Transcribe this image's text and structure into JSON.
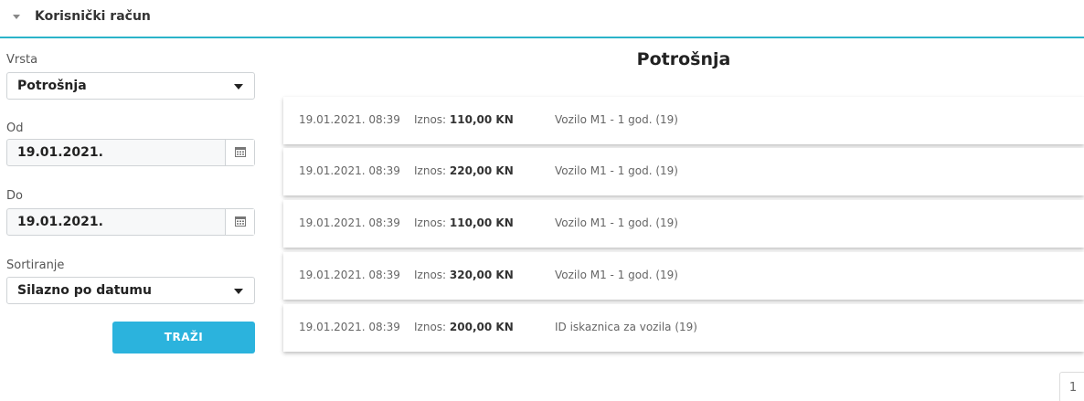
{
  "section": {
    "title": "Korisnički račun"
  },
  "filters": {
    "type": {
      "label": "Vrsta",
      "value": "Potrošnja"
    },
    "from": {
      "label": "Od",
      "value": "19.01.2021."
    },
    "to": {
      "label": "Do",
      "value": "19.01.2021."
    },
    "sort": {
      "label": "Sortiranje",
      "value": "Silazno po datumu"
    },
    "search_button": "TRAŽI"
  },
  "main": {
    "title": "Potrošnja",
    "amount_label": "Iznos:",
    "items": [
      {
        "date": "19.01.2021. 08:39",
        "amount": "110,00 KN",
        "description": "Vozilo M1 - 1 god. (19)"
      },
      {
        "date": "19.01.2021. 08:39",
        "amount": "220,00 KN",
        "description": "Vozilo M1 - 1 god. (19)"
      },
      {
        "date": "19.01.2021. 08:39",
        "amount": "110,00 KN",
        "description": "Vozilo M1 - 1 god. (19)"
      },
      {
        "date": "19.01.2021. 08:39",
        "amount": "320,00 KN",
        "description": "Vozilo M1 - 1 god. (19)"
      },
      {
        "date": "19.01.2021. 08:39",
        "amount": "200,00 KN",
        "description": "ID iskaznica za vozila (19)"
      }
    ]
  },
  "pagination": {
    "current_page": "1"
  },
  "colors": {
    "accent": "#2bb3dd",
    "divider": "#2bb3c9"
  }
}
